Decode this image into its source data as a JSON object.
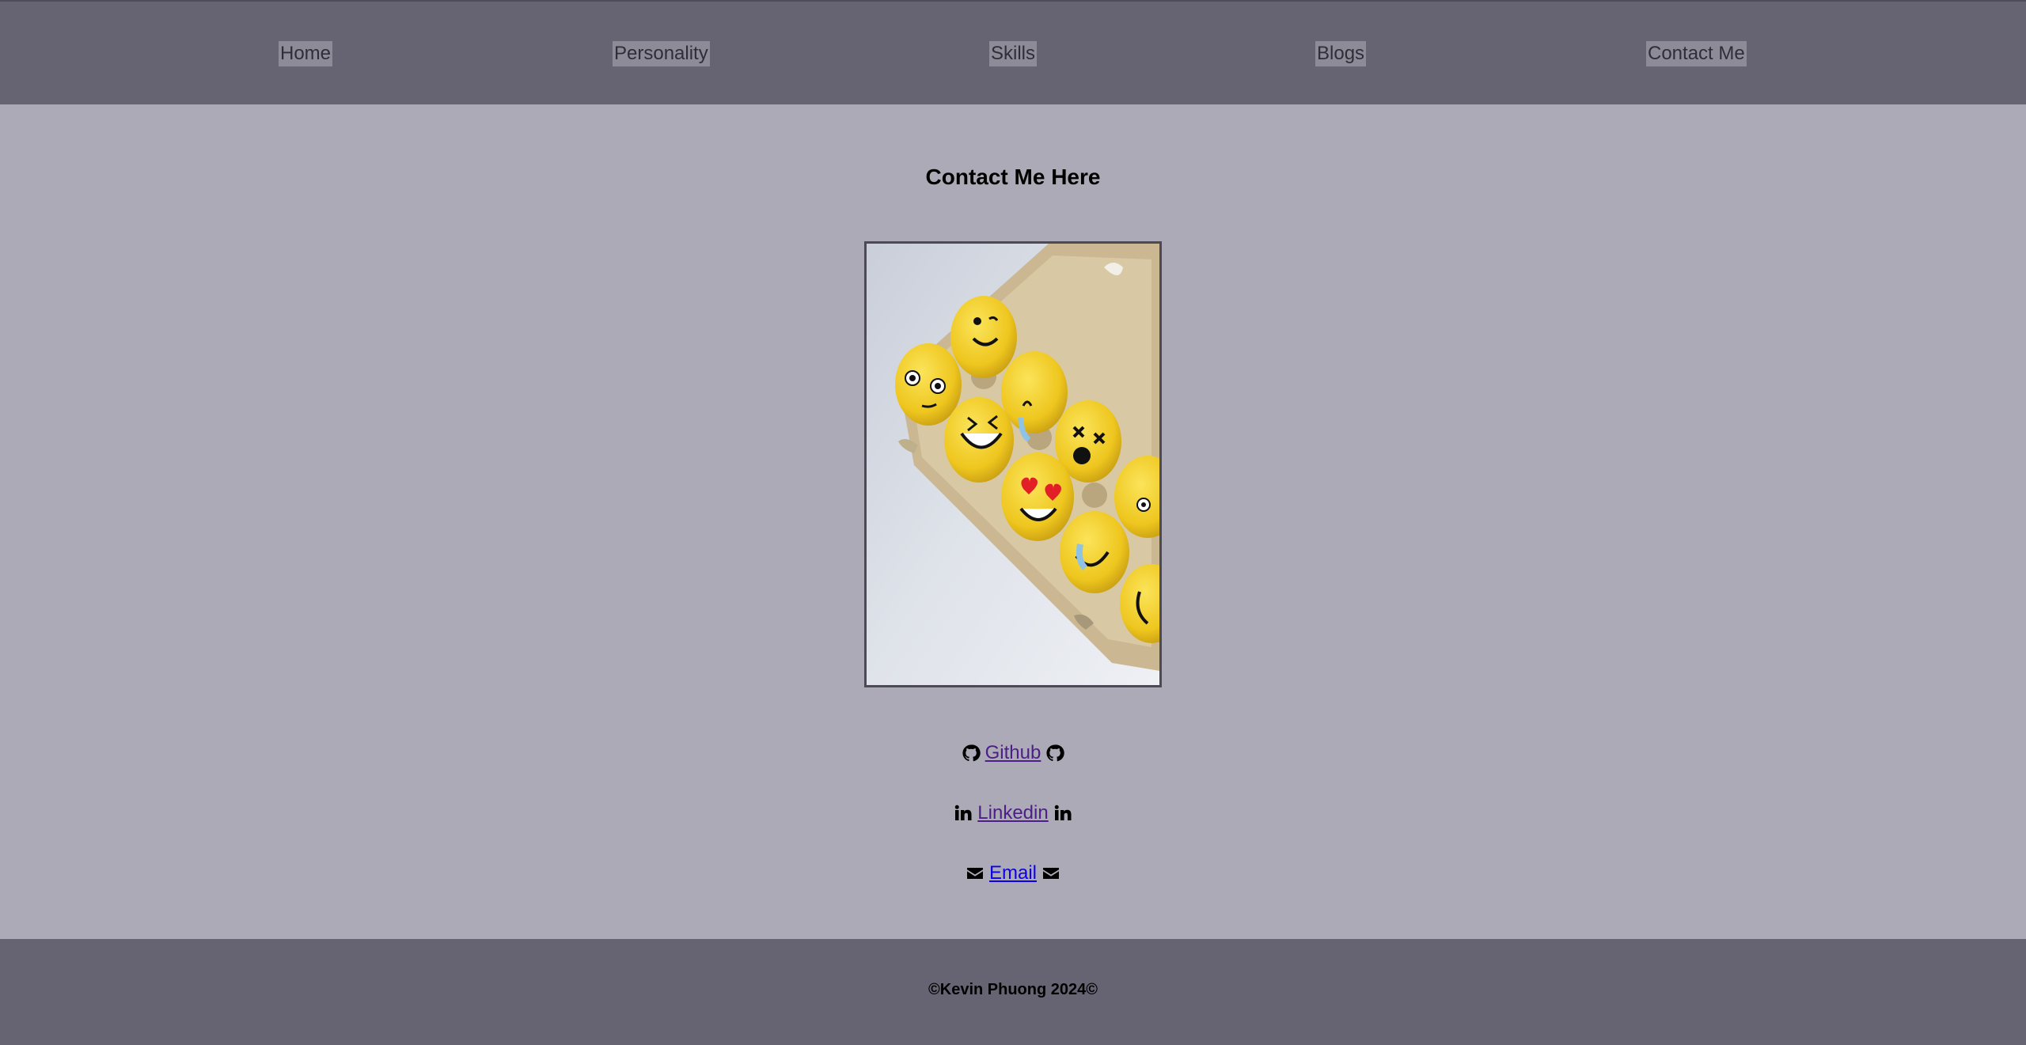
{
  "nav": {
    "items": [
      {
        "label": "Home"
      },
      {
        "label": "Personality"
      },
      {
        "label": "Skills"
      },
      {
        "label": "Blogs"
      },
      {
        "label": "Contact Me"
      }
    ]
  },
  "main": {
    "title": "Contact Me Here",
    "links": [
      {
        "label": "Github",
        "icon": "github-icon"
      },
      {
        "label": "Linkedin",
        "icon": "linkedin-icon"
      },
      {
        "label": "Email",
        "icon": "envelope-icon"
      }
    ]
  },
  "footer": {
    "text": "©Kevin Phuong 2024©"
  },
  "colors": {
    "nav_bg": "#666373",
    "page_bg": "#acaab6",
    "nav_item_bg": "#8d8b98",
    "visited_link": "#4b1f87",
    "link": "#0c00e6"
  }
}
